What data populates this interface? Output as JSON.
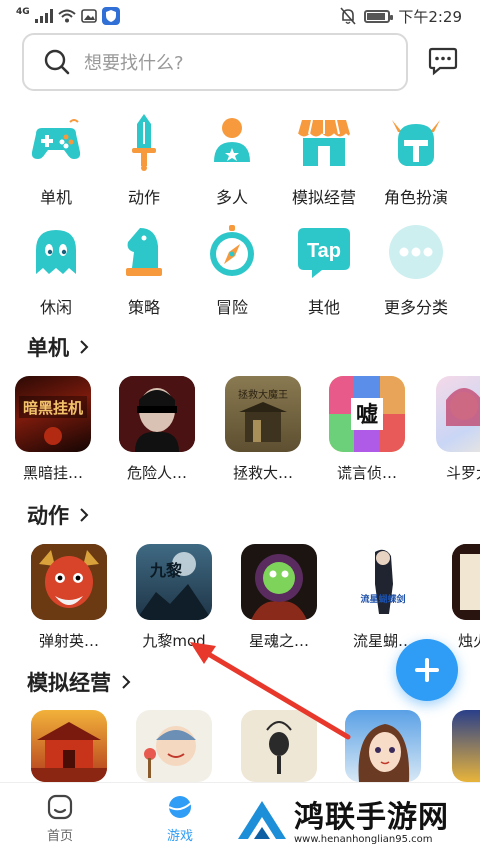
{
  "status_bar": {
    "network": "4G",
    "time": "下午2:29"
  },
  "search": {
    "placeholder": "想要找什么?"
  },
  "categories": [
    {
      "label": "单机",
      "icon": "gamepad-icon"
    },
    {
      "label": "动作",
      "icon": "sword-icon"
    },
    {
      "label": "多人",
      "icon": "people-icon"
    },
    {
      "label": "模拟经营",
      "icon": "shop-icon"
    },
    {
      "label": "角色扮演",
      "icon": "helmet-icon"
    },
    {
      "label": "休闲",
      "icon": "ghost-icon"
    },
    {
      "label": "策略",
      "icon": "chess-knight-icon"
    },
    {
      "label": "冒险",
      "icon": "compass-icon"
    },
    {
      "label": "其他",
      "icon": "tap-icon"
    },
    {
      "label": "更多分类",
      "icon": "more-dots-icon"
    }
  ],
  "sections": [
    {
      "title": "单机",
      "games": [
        {
          "name": "黑暗挂…",
          "art_text": "暗黑挂机"
        },
        {
          "name": "危险人…",
          "art_text": ""
        },
        {
          "name": "拯救大…",
          "art_text": "拯救大魔王"
        },
        {
          "name": "谎言侦…",
          "art_text": "嘘"
        },
        {
          "name": "斗罗大",
          "art_text": ""
        }
      ]
    },
    {
      "title": "动作",
      "games": [
        {
          "name": "弹射英…",
          "art_text": ""
        },
        {
          "name": "九黎mod",
          "art_text": "九黎"
        },
        {
          "name": "星魂之…",
          "art_text": ""
        },
        {
          "name": "流星蝴…",
          "art_text": "流星蝴蝶剑"
        },
        {
          "name": "烛火",
          "art_text": ""
        }
      ]
    },
    {
      "title": "模拟经营",
      "games": []
    }
  ],
  "bottom_nav": [
    {
      "label": "首页",
      "icon": "home-icon"
    },
    {
      "label": "游戏",
      "icon": "game-planet-icon"
    }
  ],
  "watermark": {
    "title": "鸿联手游网",
    "url": "www.henanhonglian95.com"
  },
  "colors": {
    "accent": "#2f9cf5",
    "icon_teal": "#2ec7c9",
    "icon_orange": "#f79a3e",
    "arrow": "#e8372b"
  }
}
